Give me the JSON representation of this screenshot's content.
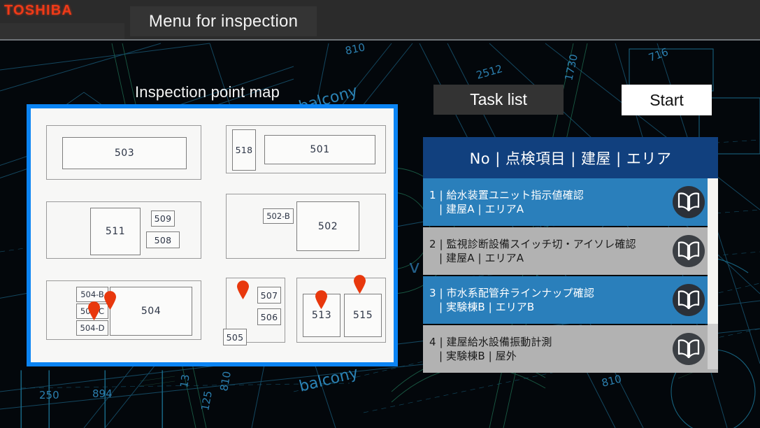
{
  "header": {
    "logo": "TOSHIBA",
    "title": "Menu for inspection"
  },
  "map": {
    "heading": "Inspection point map",
    "border_color": "#0b84f3",
    "rooms": [
      {
        "label": "503",
        "size": "normal"
      },
      {
        "label": "518",
        "size": "small"
      },
      {
        "label": "501",
        "size": "normal"
      },
      {
        "label": "511",
        "size": "normal"
      },
      {
        "label": "509",
        "size": "small"
      },
      {
        "label": "508",
        "size": "small"
      },
      {
        "label": "502-B",
        "size": "tiny"
      },
      {
        "label": "502",
        "size": "normal"
      },
      {
        "label": "504-B",
        "size": "tiny"
      },
      {
        "label": "504-C",
        "size": "tiny"
      },
      {
        "label": "504-D",
        "size": "tiny"
      },
      {
        "label": "504",
        "size": "normal"
      },
      {
        "label": "507",
        "size": "small"
      },
      {
        "label": "506",
        "size": "small"
      },
      {
        "label": "505",
        "size": "small"
      },
      {
        "label": "513",
        "size": "normal"
      },
      {
        "label": "515",
        "size": "normal"
      }
    ],
    "pin_color": "#e8380d",
    "pin_count": 5
  },
  "buttons": {
    "task_list": "Task list",
    "start": "Start"
  },
  "task_list": {
    "header": "No | 点検項目 | 建屋 | エリア",
    "header_color": "#11407e",
    "selected_color": "#2a7fbb",
    "unselected_color": "#b2b2b2",
    "rows": [
      {
        "no": "1",
        "line1": "1 | 給水装置ユニット指示値確認",
        "line2": "| 建屋A | エリアA",
        "item": "給水装置ユニット指示値確認",
        "building": "建屋A",
        "area": "エリアA",
        "selected": true
      },
      {
        "no": "2",
        "line1": "2 | 監視診断設備スイッチ切・アイソレ確認",
        "line2": "| 建屋A | エリアA",
        "item": "監視診断設備スイッチ切・アイソレ確認",
        "building": "建屋A",
        "area": "エリアA",
        "selected": false
      },
      {
        "no": "3",
        "line1": "3 | 市水系配管弁ラインナップ確認",
        "line2": "| 実験棟B | エリアB",
        "item": "市水系配管弁ラインナップ確認",
        "building": "実験棟B",
        "area": "エリアB",
        "selected": true
      },
      {
        "no": "4",
        "line1": "4 | 建屋給水設備振動計測",
        "line2": "| 実験棟B | 屋外",
        "item": "建屋給水設備振動計測",
        "building": "実験棟B",
        "area": "屋外",
        "selected": false
      }
    ],
    "scrollbar": {
      "visible": true
    }
  },
  "background": {
    "type": "blueprint",
    "line_color": "#1d5e86",
    "accent_color": "#2a6b52",
    "labels": [
      "810",
      "2512",
      "1730",
      "716",
      "810",
      "balcony",
      "250",
      "894",
      "125",
      "13",
      "balcony",
      "810"
    ]
  }
}
